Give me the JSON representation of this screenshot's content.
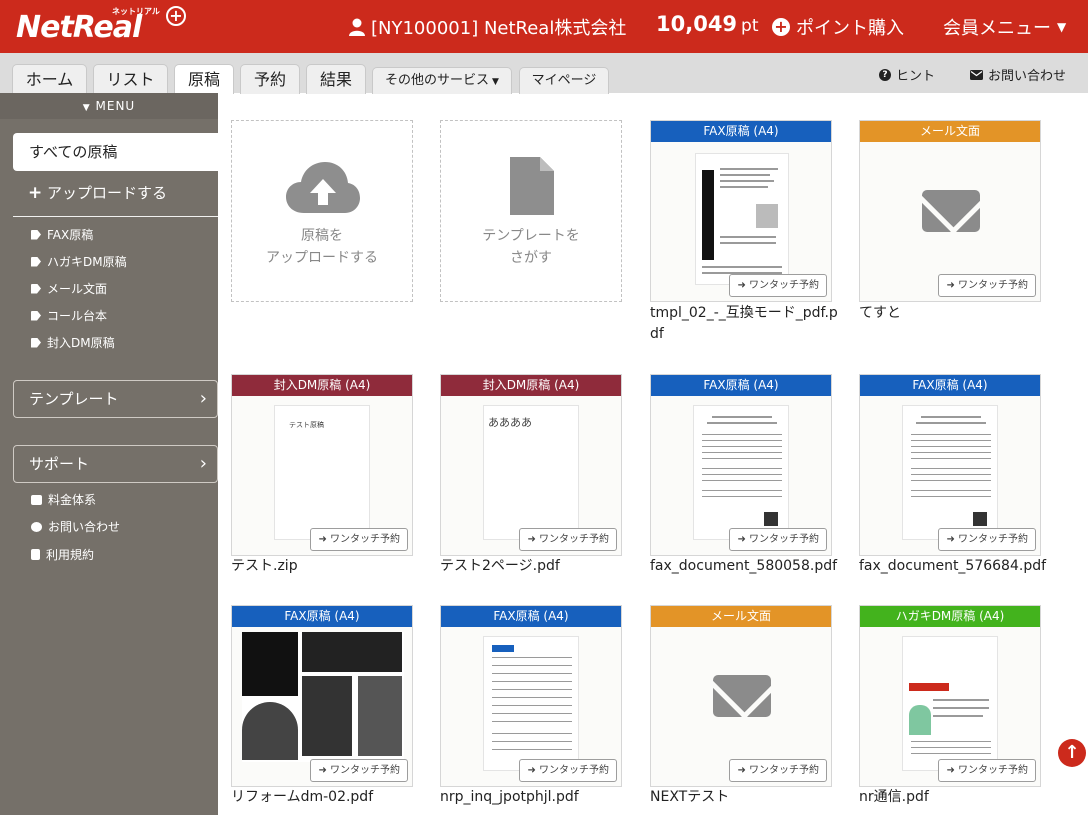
{
  "header": {
    "logo_main": "NetReal",
    "logo_sub": "ネットリアル",
    "account": "[NY100001] NetReal株式会社",
    "points_value": "10,049",
    "points_unit": "pt",
    "buy_label": "ポイント購入",
    "member_label": "会員メニュー"
  },
  "tabs": [
    {
      "label": "ホーム"
    },
    {
      "label": "リスト"
    },
    {
      "label": "原稿"
    },
    {
      "label": "予約"
    },
    {
      "label": "結果"
    },
    {
      "label": "その他のサービス"
    },
    {
      "label": "マイページ"
    }
  ],
  "help_links": {
    "hint": "ヒント",
    "contact": "お問い合わせ"
  },
  "sidebar": {
    "menu_label": "MENU",
    "all_docs": "すべての原稿",
    "upload": "アップロードする",
    "tags": [
      "FAX原稿",
      "ハガキDM原稿",
      "メール文面",
      "コール台本",
      "封入DM原稿"
    ],
    "template": "テンプレート",
    "support": "サポート",
    "support_links": [
      "料金体系",
      "お問い合わせ",
      "利用規約"
    ]
  },
  "actions": {
    "upload_card": [
      "原稿を",
      "アップロードする"
    ],
    "template_card": [
      "テンプレートを",
      "さがす"
    ]
  },
  "quick_label": "ワンタッチ予約",
  "cards": [
    {
      "type": "FAX原稿 (A4)",
      "name": "tmpl_02_-_互換モード_pdf.pdf"
    },
    {
      "type": "メール文面",
      "name": "てすと"
    },
    {
      "type": "封入DM原稿 (A4)",
      "name": "テスト.zip",
      "thumb_text": "テスト原稿"
    },
    {
      "type": "封入DM原稿 (A4)",
      "name": "テスト2ページ.pdf",
      "thumb_text": "ああああ"
    },
    {
      "type": "FAX原稿 (A4)",
      "name": "fax_document_580058.pdf"
    },
    {
      "type": "FAX原稿 (A4)",
      "name": "fax_document_576684.pdf"
    },
    {
      "type": "FAX原稿 (A4)",
      "name": "リフォームdm-02.pdf"
    },
    {
      "type": "FAX原稿 (A4)",
      "name": "nrp_inq_jpotphjl.pdf"
    },
    {
      "type": "メール文面",
      "name": "NEXTテスト"
    },
    {
      "type": "ハガキDM原稿 (A4)",
      "name": "nr通信.pdf"
    }
  ]
}
